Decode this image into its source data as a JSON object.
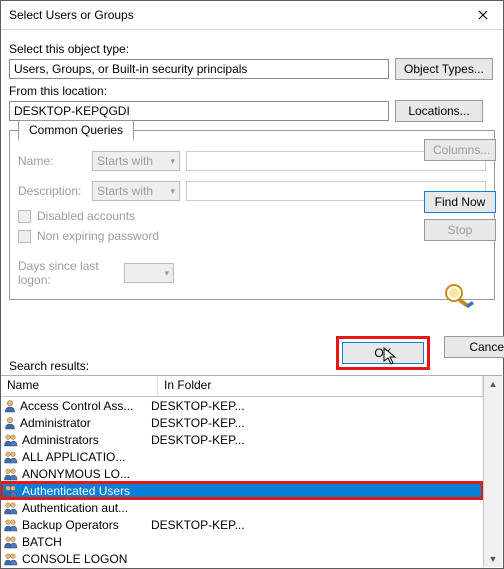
{
  "window": {
    "title": "Select Users or Groups"
  },
  "objectType": {
    "label": "Select this object type:",
    "value": "Users, Groups, or Built-in security principals",
    "button": "Object Types..."
  },
  "location": {
    "label": "From this location:",
    "value": "DESKTOP-KEPQGDI",
    "button": "Locations..."
  },
  "queries": {
    "tab": "Common Queries",
    "nameLabel": "Name:",
    "nameMode": "Starts with",
    "descLabel": "Description:",
    "descMode": "Starts with",
    "disabledAccounts": "Disabled accounts",
    "nonExpiring": "Non expiring password",
    "daysLabel": "Days since last logon:"
  },
  "side": {
    "columns": "Columns...",
    "findNow": "Find Now",
    "stop": "Stop"
  },
  "actions": {
    "ok": "OK",
    "cancel": "Cancel"
  },
  "search": {
    "label": "Search results:",
    "colName": "Name",
    "colFolder": "In Folder"
  },
  "results": [
    {
      "type": "user",
      "name": "Access Control Ass...",
      "folder": "DESKTOP-KEP...",
      "selected": false
    },
    {
      "type": "user",
      "name": "Administrator",
      "folder": "DESKTOP-KEP...",
      "selected": false
    },
    {
      "type": "group",
      "name": "Administrators",
      "folder": "DESKTOP-KEP...",
      "selected": false
    },
    {
      "type": "group",
      "name": "ALL APPLICATIO...",
      "folder": "",
      "selected": false
    },
    {
      "type": "group",
      "name": "ANONYMOUS LO...",
      "folder": "",
      "selected": false
    },
    {
      "type": "group",
      "name": "Authenticated Users",
      "folder": "",
      "selected": true
    },
    {
      "type": "group",
      "name": "Authentication aut...",
      "folder": "",
      "selected": false
    },
    {
      "type": "group",
      "name": "Backup Operators",
      "folder": "DESKTOP-KEP...",
      "selected": false
    },
    {
      "type": "group",
      "name": "BATCH",
      "folder": "",
      "selected": false
    },
    {
      "type": "group",
      "name": "CONSOLE LOGON",
      "folder": "",
      "selected": false
    }
  ]
}
